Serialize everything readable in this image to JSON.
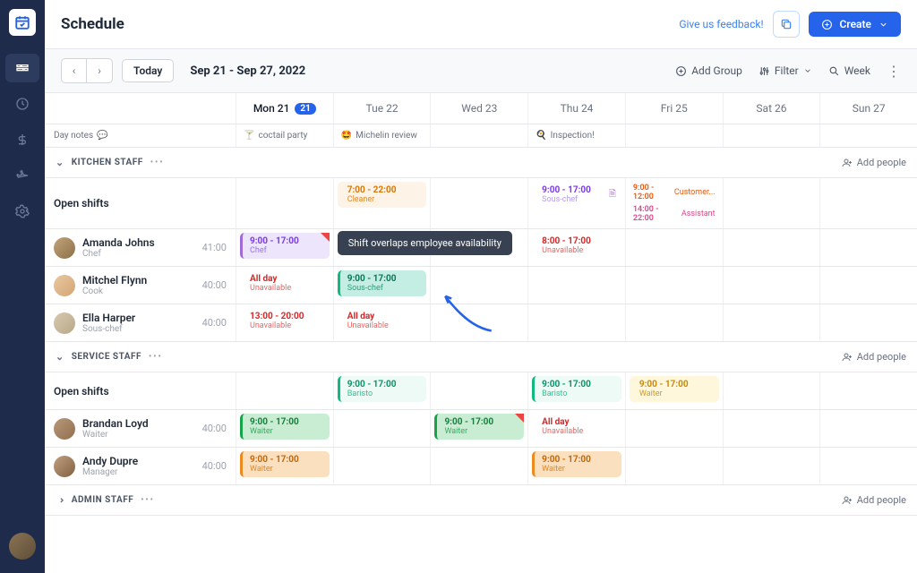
{
  "header": {
    "title": "Schedule",
    "feedback": "Give us feedback!",
    "create": "Create"
  },
  "toolbar": {
    "today": "Today",
    "date_range": "Sep 21 - Sep 27, 2022",
    "add_group": "Add Group",
    "filter": "Filter",
    "week": "Week"
  },
  "days": [
    {
      "label": "Mon 21",
      "active": true,
      "badge": "21"
    },
    {
      "label": "Tue 22"
    },
    {
      "label": "Wed 23"
    },
    {
      "label": "Thu 24"
    },
    {
      "label": "Fri 25"
    },
    {
      "label": "Sat 26"
    },
    {
      "label": "Sun 27"
    }
  ],
  "notes": {
    "label": "Day notes",
    "items": [
      "coctail party",
      "Michelin review",
      "",
      "Inspection!",
      "",
      "",
      ""
    ]
  },
  "groups": {
    "kitchen": {
      "title": "KITCHEN STAFF",
      "add_people": "Add people",
      "open_label": "Open shifts",
      "open": {
        "tue": {
          "time": "7:00 - 22:00",
          "role": "Cleaner"
        },
        "thu": {
          "time": "9:00 - 17:00",
          "role": "Sous-chef"
        },
        "fri_a": {
          "time": "9:00 - 12:00",
          "role": "Customer..."
        },
        "fri_b": {
          "time": "14:00 - 22:00",
          "role": "Assistant"
        }
      },
      "rows": [
        {
          "name": "Amanda Johns",
          "role": "Chef",
          "hours": "41:00",
          "mon": {
            "time": "9:00 - 17:00",
            "role": "Chef"
          },
          "thu": {
            "time": "8:00 - 17:00",
            "role": "Unavailable"
          },
          "tooltip": "Shift overlaps employee availability"
        },
        {
          "name": "Mitchel Flynn",
          "role": "Cook",
          "hours": "40:00",
          "mon": {
            "time": "All day",
            "role": "Unavailable"
          },
          "tue": {
            "time": "9:00 - 17:00",
            "role": "Sous-chef"
          }
        },
        {
          "name": "Ella Harper",
          "role": "Sous-chef",
          "hours": "40:00",
          "mon": {
            "time": "13:00 - 20:00",
            "role": "Unavailable"
          },
          "tue": {
            "time": "All day",
            "role": "Unavailable"
          }
        }
      ]
    },
    "service": {
      "title": "SERVICE STAFF",
      "add_people": "Add people",
      "open_label": "Open shifts",
      "open": {
        "tue": {
          "time": "9:00 - 17:00",
          "role": "Baristo"
        },
        "thu": {
          "time": "9:00 - 17:00",
          "role": "Baristo"
        },
        "fri": {
          "time": "9:00 - 17:00",
          "role": "Waiter"
        }
      },
      "rows": [
        {
          "name": "Brandan Loyd",
          "role": "Waiter",
          "hours": "40:00",
          "mon": {
            "time": "9:00 - 17:00",
            "role": "Waiter"
          },
          "wed": {
            "time": "9:00 - 17:00",
            "role": "Waiter"
          },
          "thu": {
            "time": "All day",
            "role": "Unavailable"
          }
        },
        {
          "name": "Andy Dupre",
          "role": "Manager",
          "hours": "40:00",
          "mon": {
            "time": "9:00 - 17:00",
            "role": "Waiter"
          },
          "thu": {
            "time": "9:00 - 17:00",
            "role": "Waiter"
          }
        }
      ]
    },
    "admin": {
      "title": "ADMIN STAFF",
      "add_people": "Add people"
    }
  }
}
